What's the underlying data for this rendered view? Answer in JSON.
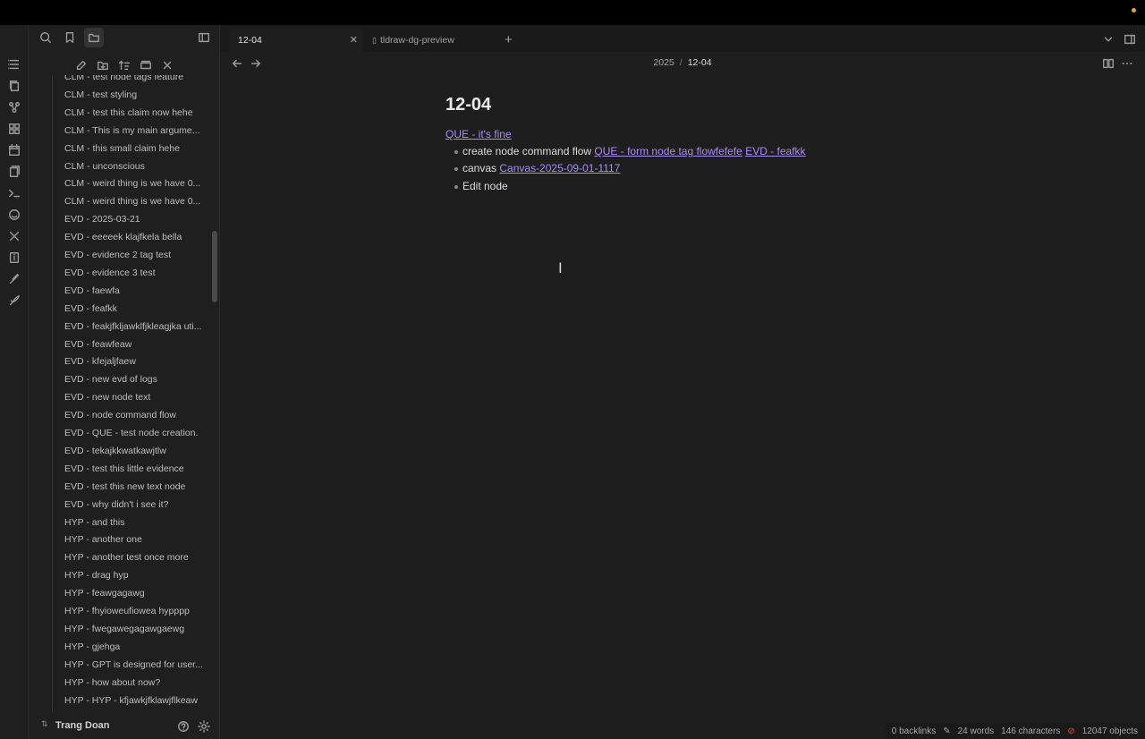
{
  "window": {
    "accent": "#a88bfa",
    "status_dot_color": "#e8a33d"
  },
  "ribbon": {
    "icons": [
      "files-icon",
      "copy-icon",
      "graph-icon",
      "blocks-icon",
      "calendar-icon",
      "pages-icon",
      "terminal-icon",
      "smile-icon",
      "tools-icon",
      "info-icon",
      "brush-icon",
      "rocket-icon"
    ]
  },
  "sidebar": {
    "top_icons": [
      "search-icon",
      "bookmark-icon",
      "folder-icon",
      "sidebar-toggle-icon"
    ],
    "actions": [
      "new-note-icon",
      "new-folder-icon",
      "sort-icon",
      "collapse-icon",
      "close-icon"
    ],
    "files": [
      "CLM - test node tags feature",
      "CLM - test styling",
      "CLM - test this claim now hehe",
      "CLM - This is my main argume...",
      "CLM - this small claim hehe",
      "CLM - unconscious",
      "CLM - weird thing is we have 0...",
      "CLM - weird thing is we have 0...",
      "EVD - 2025-03-21",
      "EVD - eeeeek klajfkela bella",
      "EVD - evidence 2 tag test",
      "EVD - evidence 3 test",
      "EVD - faewfa",
      "EVD - feafkk",
      "EVD - feakjfkljawklfjkleagjka uti...",
      "EVD - feawfeaw",
      "EVD - kfejaljfaew",
      "EVD - new evd of logs",
      "EVD - new node text",
      "EVD - node command flow",
      "EVD - QUE - test node creation.",
      "EVD - tekajkkwatkawjtlw",
      "EVD - test this little evidence",
      "EVD - test this new text node",
      "EVD - why didn't i see it?",
      "HYP - and this",
      "HYP - another one",
      "HYP - another test once more",
      "HYP - drag hyp",
      "HYP - feawgagawg",
      "HYP - fhyioweufiowea hypppp",
      "HYP - fwegawegagawgaewg",
      "HYP - gjehga",
      "HYP - GPT is designed for user...",
      "HYP - how about now?",
      "HYP - HYP - kfjawkjfklawjflkeaw"
    ],
    "vault_name": "Trang Doan"
  },
  "tabs": [
    {
      "label": "12-04",
      "active": true,
      "close": "✕"
    },
    {
      "label": "tldraw-dg-preview",
      "active": false
    }
  ],
  "new_tab_label": "+",
  "breadcrumb": {
    "parent": "2025",
    "separator": "/",
    "current": "12-04"
  },
  "note": {
    "title": "12-04",
    "first_link": "QUE - it's fine",
    "bullets": [
      {
        "text": "create node command flow",
        "links": [
          "QUE - form node tag flowfefefe",
          "EVD - feafkk"
        ]
      },
      {
        "text": "canvas",
        "links": [
          "Canvas-2025-09-01-1117"
        ]
      },
      {
        "text": "Edit node",
        "links": []
      }
    ]
  },
  "statusbar": {
    "backlinks": "0 backlinks",
    "words": "24 words",
    "characters": "146 characters",
    "objects": "12047 objects"
  }
}
